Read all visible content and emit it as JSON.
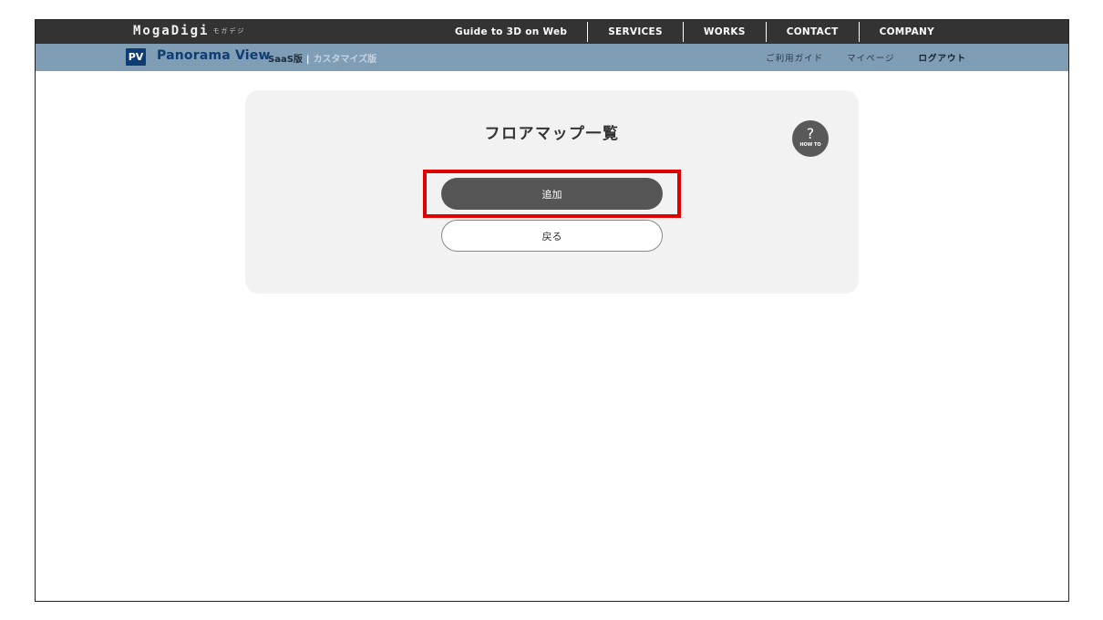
{
  "header": {
    "brand": "MogaDigi",
    "brand_kana": "モガデジ",
    "nav": [
      "Guide to 3D on Web",
      "SERVICES",
      "WORKS",
      "CONTACT",
      "COMPANY"
    ]
  },
  "subheader": {
    "logo_text": "PV",
    "product": "Panorama View",
    "plan_saas": "SaaS版",
    "plan_sep": "|",
    "plan_custom": "カスタマイズ版",
    "links": {
      "guide": "ご利用ガイド",
      "mypage": "マイページ",
      "logout": "ログアウト"
    }
  },
  "main": {
    "title": "フロアマップ一覧",
    "help_symbol": "?",
    "help_label": "HOW TO",
    "add_button": "追加",
    "back_button": "戻る"
  },
  "colors": {
    "topbar": "#333333",
    "subbar": "#7f9db5",
    "brand_navy": "#0e3d73",
    "highlight": "#e00000",
    "primary_button": "#555555"
  }
}
